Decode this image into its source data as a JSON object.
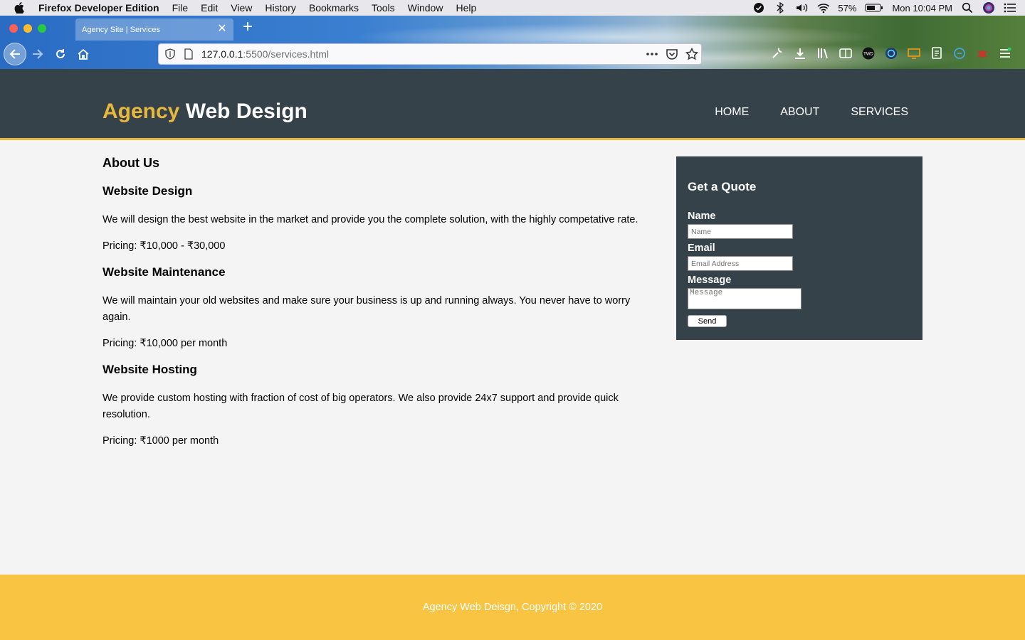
{
  "menubar": {
    "app_name": "Firefox Developer Edition",
    "items": [
      "File",
      "Edit",
      "View",
      "History",
      "Bookmarks",
      "Tools",
      "Window",
      "Help"
    ],
    "battery": "57%",
    "clock": "Mon 10:04 PM"
  },
  "browser": {
    "tab_title": "Agency Site | Services",
    "url_host": "127.0.0.1",
    "url_path": ":5500/services.html"
  },
  "site": {
    "brand_highlight": "Agency",
    "brand_rest": " Web Design",
    "nav": [
      "HOME",
      "ABOUT",
      "SERVICES"
    ],
    "heading": "About Us",
    "services": [
      {
        "title": "Website Design",
        "description": "We will design the best website in the market and provide you the complete solution, with the highly competative rate.",
        "pricing": "Pricing: ₹10,000 - ₹30,000"
      },
      {
        "title": "Website Maintenance",
        "description": "We will maintain your old websites and make sure your business is up and running always. You never have to worry again.",
        "pricing": "Pricing: ₹10,000 per month"
      },
      {
        "title": "Website Hosting",
        "description": "We provide custom hosting with fraction of cost of big operators. We also provide 24x7 support and provide quick resolution.",
        "pricing": "Pricing: ₹1000 per month"
      }
    ],
    "quote": {
      "title": "Get a Quote",
      "name_label": "Name",
      "name_placeholder": "Name",
      "email_label": "Email",
      "email_placeholder": "Email Address",
      "message_label": "Message",
      "message_placeholder": "Message",
      "send_label": "Send"
    },
    "footer": "Agency Web Deisgn, Copyright © 2020"
  },
  "colors": {
    "header_bg": "#35424a",
    "accent": "#e8b73d",
    "footer_bg": "#f8c441",
    "page_bg": "#f4f4f4"
  }
}
